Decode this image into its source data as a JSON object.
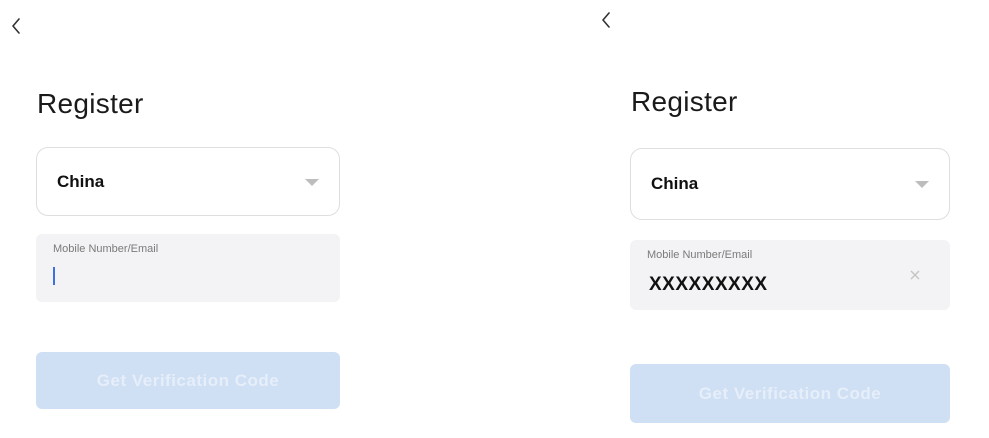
{
  "screens": [
    {
      "title": "Register",
      "country": {
        "label": "China"
      },
      "account_field": {
        "label": "Mobile Number/Email",
        "value": "",
        "state": "focused-empty"
      },
      "submit_button": {
        "label": "Get Verification Code",
        "enabled": false
      }
    },
    {
      "title": "Register",
      "country": {
        "label": "China"
      },
      "account_field": {
        "label": "Mobile Number/Email",
        "value": "XXXXXXXXX",
        "state": "filled"
      },
      "submit_button": {
        "label": "Get Verification Code",
        "enabled": false
      }
    }
  ],
  "icons": {
    "back": "chevron-left-icon",
    "dropdown": "caret-down-icon",
    "clear": "close-icon"
  },
  "colors": {
    "cursor": "#3d6fe0",
    "button_disabled_bg": "#cfdff4",
    "input_bg": "#f3f3f5"
  }
}
